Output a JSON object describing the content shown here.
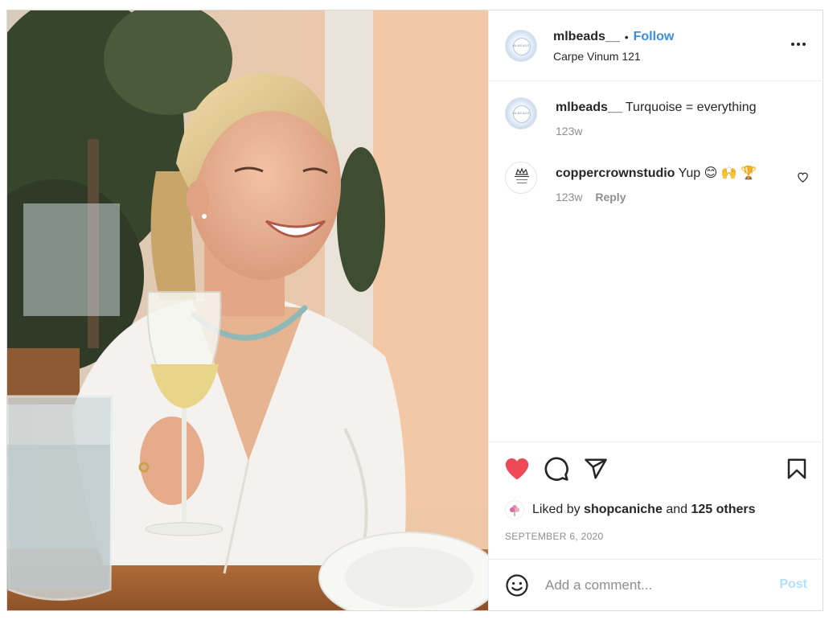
{
  "post": {
    "username": "mlbeads__",
    "separator": "•",
    "follow_label": "Follow",
    "location": "Carpe Vinum 121",
    "avatar_text": "MLBEADS"
  },
  "caption": {
    "username": "mlbeads__",
    "text": "Turquoise = everything",
    "age": "123w"
  },
  "comments": [
    {
      "username": "coppercrownstudio",
      "text": "Yup 😊 🙌 🏆",
      "age": "123w",
      "reply_label": "Reply",
      "avatar_text": "copper crown studio"
    }
  ],
  "likes": {
    "prefix": "Liked by",
    "user": "shopcaniche",
    "joiner": "and",
    "others": "125 others"
  },
  "date": "SEPTEMBER 6, 2020",
  "add_comment": {
    "placeholder": "Add a comment...",
    "post_label": "Post"
  },
  "icons": {
    "like": "heart-filled-icon",
    "comment": "comment-icon",
    "share": "share-icon",
    "save": "bookmark-icon",
    "emoji": "emoji-icon",
    "more": "more-icon"
  },
  "colors": {
    "follow": "#3b8de0",
    "liked_heart": "#ed4956",
    "post_disabled": "#b2dffc"
  }
}
